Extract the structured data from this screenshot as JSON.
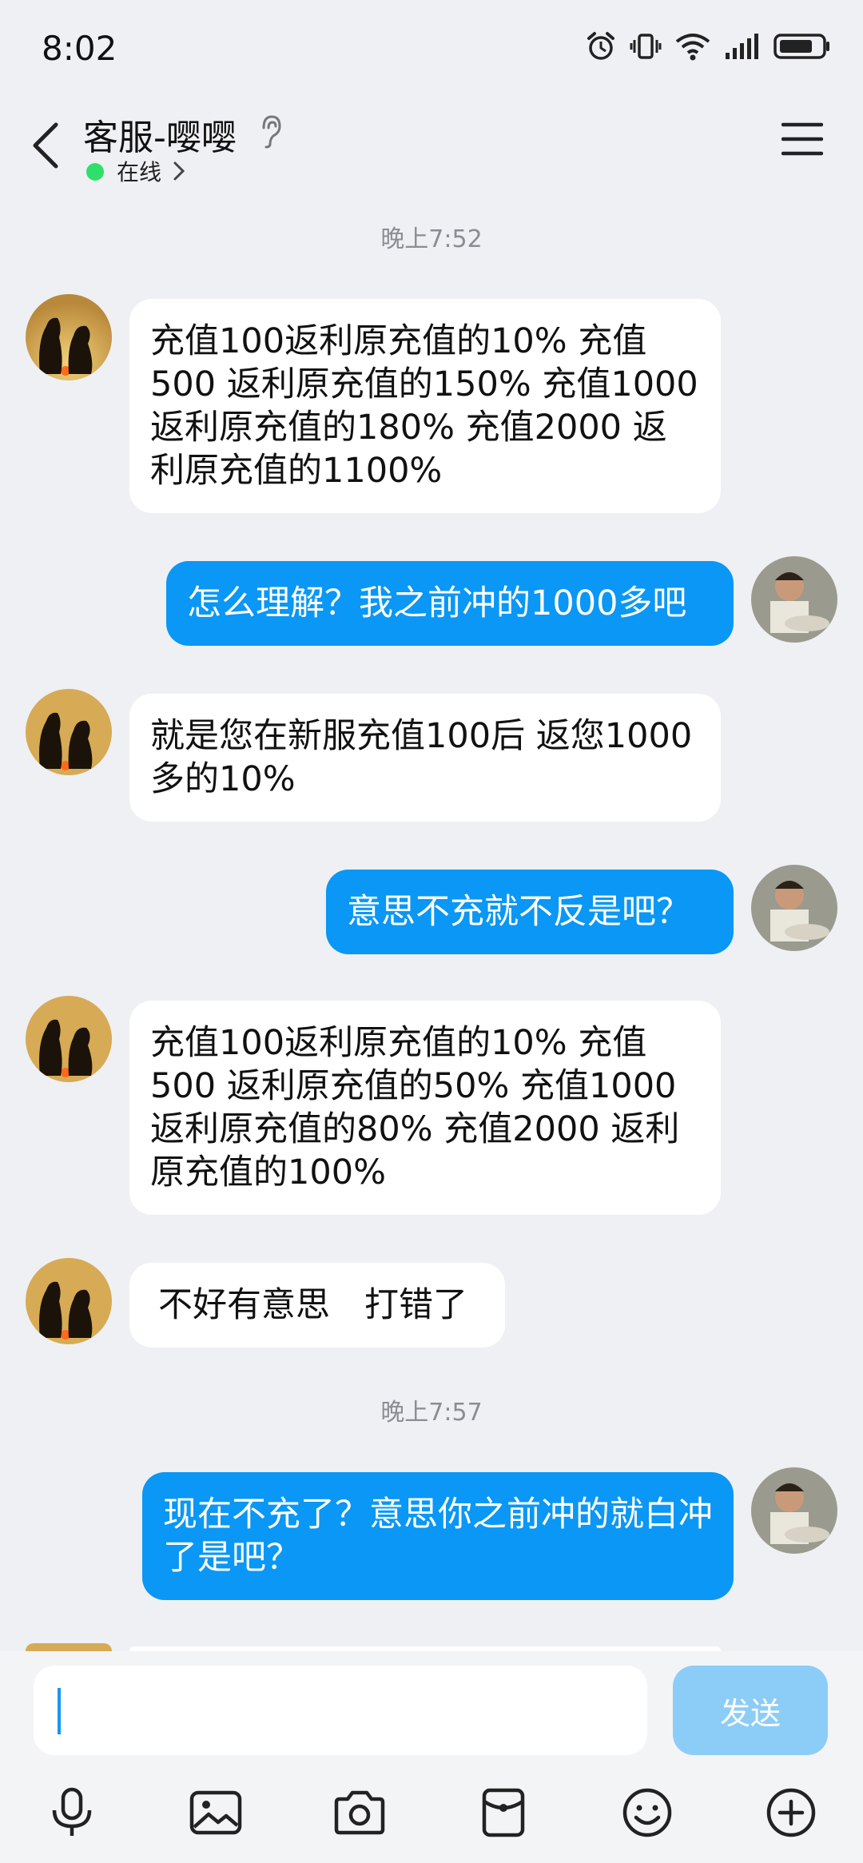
{
  "status_bar": {
    "time": "8:02"
  },
  "header": {
    "contact_name": "客服-嘤嘤",
    "status_label": "在线"
  },
  "timestamps": [
    "晚上7:52",
    "晚上7:57"
  ],
  "messages": [
    {
      "side": "in",
      "text": "充值100返利原充值的10% 充值500 返利原充值的150% 充值1000返利原充值的180% 充值2000 返利原充值的1100%"
    },
    {
      "side": "out",
      "text": "怎么理解？我之前冲的1000多吧"
    },
    {
      "side": "in",
      "text": "就是您在新服充值100后 返您1000多的10%"
    },
    {
      "side": "out",
      "text": "意思不充就不反是吧？"
    },
    {
      "side": "in",
      "text": "充值100返利原充值的10% 充值500 返利原充值的50% 充值1000返利原充值的80% 充值2000 返利原充值的100%"
    },
    {
      "side": "in",
      "text": "不好有意思　打错了"
    },
    {
      "side": "out",
      "text": "现在不充了？意思你之前冲的就白冲了是吧？"
    }
  ],
  "composer": {
    "input_value": "",
    "send_label": "发送"
  },
  "toolbar": {
    "icons": [
      "microphone-icon",
      "image-icon",
      "camera-icon",
      "red-packet-icon",
      "emoji-icon",
      "plus-icon"
    ]
  },
  "colors": {
    "accent": "#0a97f5",
    "send_disabled": "#8ccdf8",
    "online": "#2ee06a",
    "background": "#eef0f3"
  }
}
